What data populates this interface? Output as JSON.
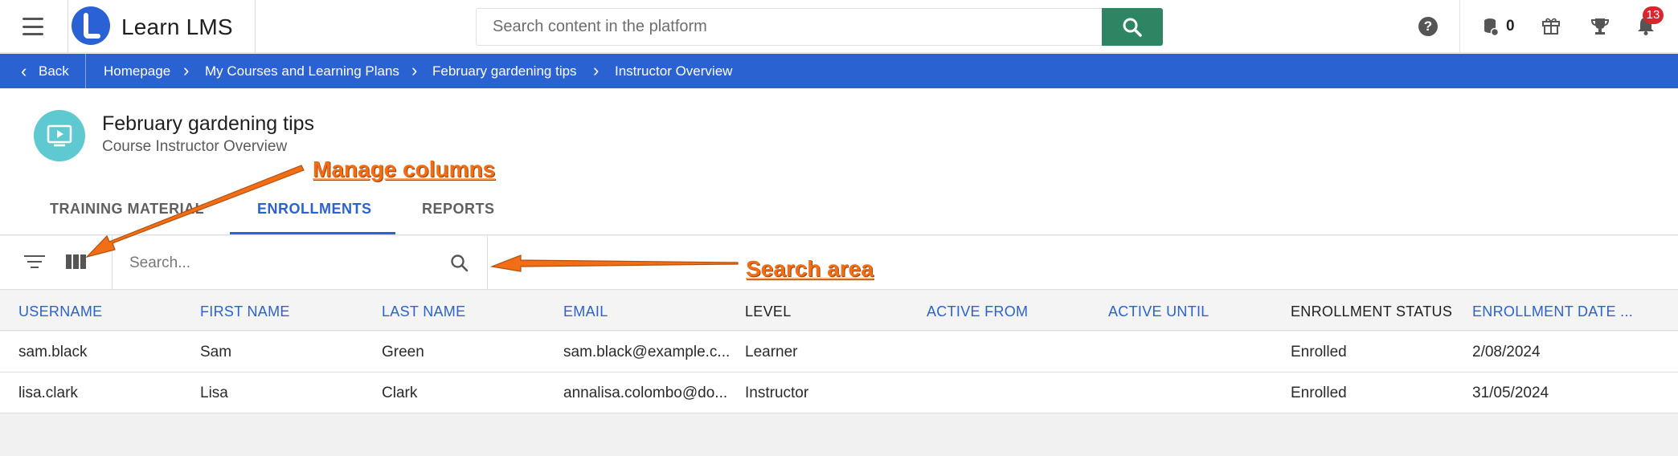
{
  "app": {
    "brand": "Learn LMS"
  },
  "topbar": {
    "search_placeholder": "Search content in the platform",
    "coins": "0",
    "notifications": "13",
    "icons": [
      "menu-icon",
      "search-icon",
      "help-icon",
      "coins-icon",
      "gift-icon",
      "trophy-icon",
      "bell-icon"
    ]
  },
  "breadcrumb": {
    "back": "Back",
    "items": [
      "Homepage",
      "My Courses and Learning Plans",
      "February gardening tips",
      "Instructor Overview"
    ]
  },
  "course": {
    "title": "February gardening tips",
    "subtitle": "Course Instructor Overview"
  },
  "tabs": [
    "TRAINING MATERIAL",
    "ENROLLMENTS",
    "REPORTS"
  ],
  "active_tab": "ENROLLMENTS",
  "toolbar": {
    "search_placeholder": "Search..."
  },
  "table": {
    "columns": [
      "USERNAME",
      "FIRST NAME",
      "LAST NAME",
      "EMAIL",
      "LEVEL",
      "ACTIVE FROM",
      "ACTIVE UNTIL",
      "ENROLLMENT STATUS",
      "ENROLLMENT DATE ..."
    ],
    "rows": [
      [
        "sam.black",
        "Sam",
        "Green",
        "sam.black@example.c...",
        "Learner",
        "",
        "",
        "Enrolled",
        "2/08/2024"
      ],
      [
        "lisa.clark",
        "Lisa",
        "Clark",
        "annalisa.colombo@do...",
        "Instructor",
        "",
        "",
        "Enrolled",
        "31/05/2024"
      ]
    ]
  },
  "annotations": {
    "manage_columns": "Manage columns",
    "search_area": "Search area"
  },
  "colors": {
    "brand_blue": "#2b62d1",
    "search_green": "#2e8564",
    "annotation_orange": "#f26e16",
    "course_icon": "#5ec9d1"
  }
}
